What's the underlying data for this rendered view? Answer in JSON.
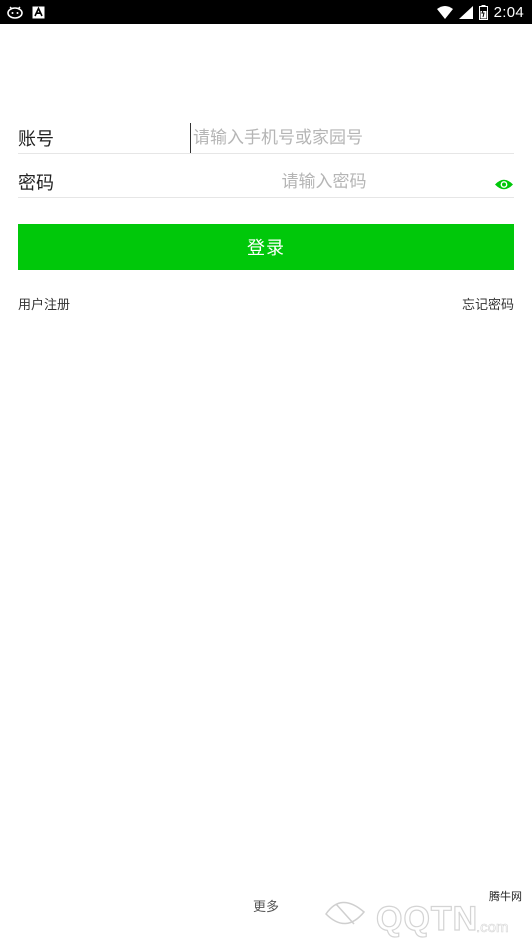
{
  "status_bar": {
    "time": "2:04",
    "left_icons": [
      "android-notification-icon",
      "text-a-icon"
    ],
    "right_icons": [
      "wifi-icon",
      "signal-icon",
      "battery-icon"
    ]
  },
  "form": {
    "account_label": "账号",
    "account_placeholder": "请输入手机号或家园号",
    "password_label": "密码",
    "password_placeholder": "请输入密码"
  },
  "login_button": {
    "label": "登录",
    "color": "#00c80a"
  },
  "links": {
    "register": "用户注册",
    "forgot": "忘记密码"
  },
  "footer": {
    "more": "更多"
  },
  "watermark": {
    "brand_top": "腾牛网",
    "brand_main": "QQTN",
    "domain": ".com"
  },
  "colors": {
    "accent": "#00c80a",
    "status_bar": "#000000",
    "divider": "#e6e6e6"
  }
}
